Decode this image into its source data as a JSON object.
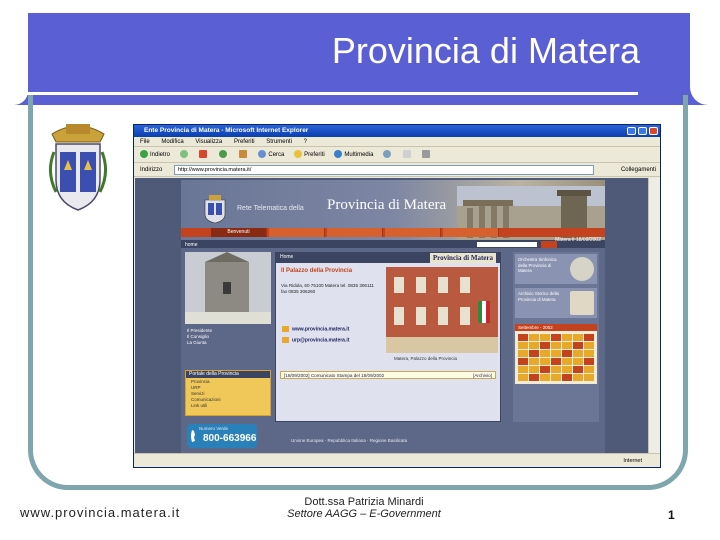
{
  "slide": {
    "title": "Provincia di Matera",
    "footer_url": "www.provincia.matera.it",
    "author_line1": "Dott.ssa Patrizia Minardi",
    "author_line2": "Settore AAGG – E-Government",
    "page_number": "1",
    "accent_color": "#5a5fd4",
    "frame_color": "#7fa6ad"
  },
  "browser": {
    "window_title": "Ente Provincia di Matera - Microsoft Internet Explorer",
    "menu": [
      "File",
      "Modifica",
      "Visualizza",
      "Preferiti",
      "Strumenti",
      "?"
    ],
    "toolbar": [
      "Indietro",
      "Cerca",
      "Preferiti",
      "Multimedia"
    ],
    "address_label": "Indirizzo",
    "address_value": "http://www.provincia.matera.it/",
    "address_links": "Collegamenti",
    "status_left": "",
    "status_right": "Internet"
  },
  "site": {
    "net_label": "Rete Telematica della",
    "name": "Provincia di Matera",
    "nav_tabs": [
      "Benvenuti",
      "",
      "",
      "",
      ""
    ],
    "date": "Matera lì 18/09/2002",
    "strip_home": "home",
    "left_links": [
      "Il Presidente",
      "Il Consiglio",
      "La Giunta"
    ],
    "left_box_title": "Portale della Provincia",
    "left_box_items": [
      "Provincia",
      "URP",
      "Servizi",
      "Comunicazioni",
      "Link utili"
    ],
    "phone_label": "Numero Verde",
    "phone_number": "800-663966",
    "center_head_left": "Home",
    "center_head_right": "Provincia di Matera",
    "palazzo_title": "Il Palazzo della Provincia",
    "palazzo_text": "Via Ridola, 60 75100 Matera tel. 0835 306111 fax 0835 306260",
    "palazzo_caption": "Matera, Palazzo della Provincia",
    "link_www": "www.provincia.matera.it",
    "link_mail": "urp@provincia.matera.it",
    "news_date": "[18/09/2002]",
    "news_text": "Comunicato Stampa del 18/09/2002",
    "news_archive": "[Archivio]",
    "right_b1": "Orchestra Sinfonica della Provincia di Matera",
    "right_b2": "Archivio Storico della Provincia di Matera",
    "cal_title": "Settembre - 2002",
    "footer_logos": "Unione Europea · Repubblica Italiana · Regione Basilicata"
  }
}
